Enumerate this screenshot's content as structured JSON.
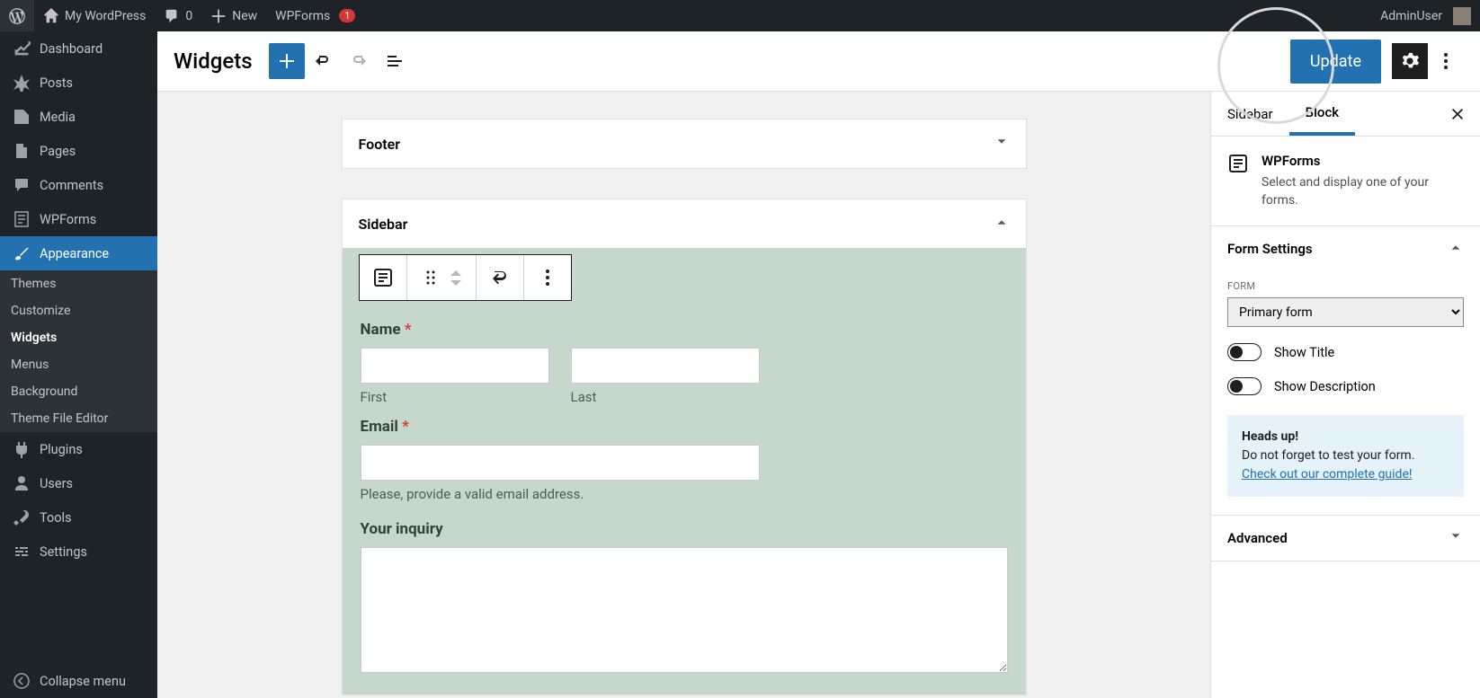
{
  "adminbar": {
    "site_name": "My WordPress",
    "comment_count": "0",
    "new_label": "New",
    "wpforms_label": "WPForms",
    "wpforms_badge": "1",
    "user_name": "AdminUser"
  },
  "sidebar": {
    "items": [
      {
        "label": "Dashboard"
      },
      {
        "label": "Posts"
      },
      {
        "label": "Media"
      },
      {
        "label": "Pages"
      },
      {
        "label": "Comments"
      },
      {
        "label": "WPForms"
      },
      {
        "label": "Appearance"
      },
      {
        "label": "Plugins"
      },
      {
        "label": "Users"
      },
      {
        "label": "Tools"
      },
      {
        "label": "Settings"
      }
    ],
    "appearance_sub": [
      {
        "label": "Themes"
      },
      {
        "label": "Customize"
      },
      {
        "label": "Widgets"
      },
      {
        "label": "Menus"
      },
      {
        "label": "Background"
      },
      {
        "label": "Theme File Editor"
      }
    ],
    "collapse_label": "Collapse menu"
  },
  "editor": {
    "title": "Widgets",
    "update_label": "Update"
  },
  "widget_areas": {
    "footer": {
      "title": "Footer"
    },
    "sidebar": {
      "title": "Sidebar"
    }
  },
  "form": {
    "name_label": "Name",
    "first_sub": "First",
    "last_sub": "Last",
    "email_label": "Email",
    "email_hint": "Please, provide a valid email address.",
    "inquiry_label": "Your inquiry"
  },
  "rside": {
    "tab1": "Sidebar",
    "tab2": "Block",
    "block_title": "WPForms",
    "block_desc": "Select and display one of your forms.",
    "section_form": "Form Settings",
    "form_label": "FORM",
    "form_selected": "Primary form",
    "show_title": "Show Title",
    "show_desc": "Show Description",
    "heads_up": "Heads up!",
    "notice_text": "Do not forget to test your form.",
    "notice_link": "Check out our complete guide!",
    "section_advanced": "Advanced"
  }
}
